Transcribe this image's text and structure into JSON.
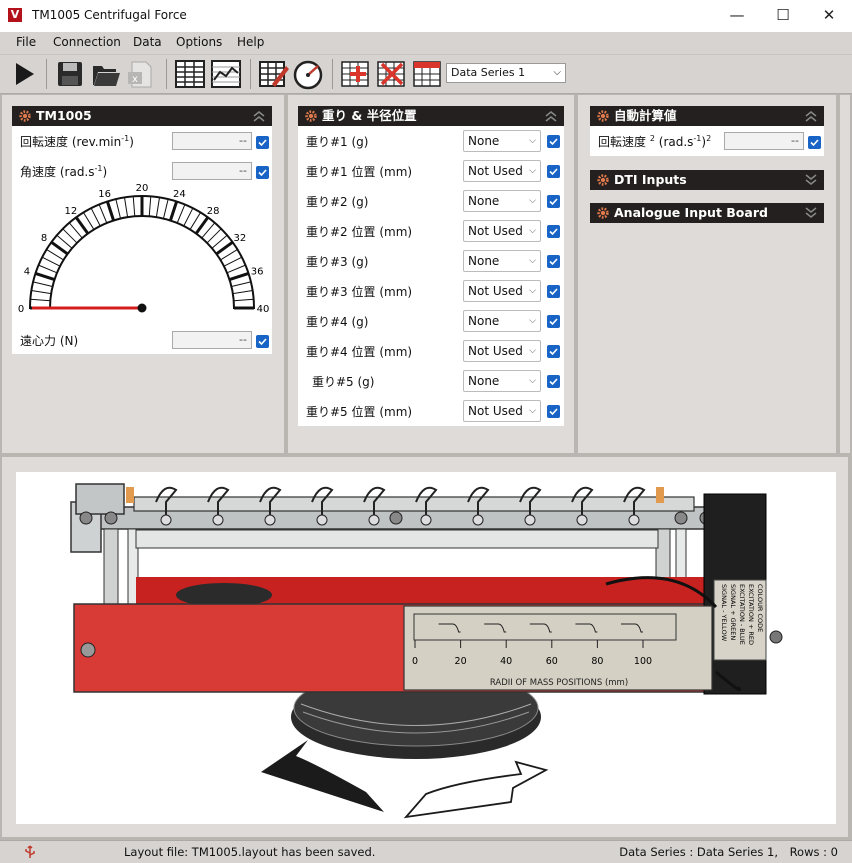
{
  "window": {
    "app_icon_letter": "V",
    "title": "TM1005 Centrifugal Force",
    "minimize": "—",
    "maximize": "☐",
    "close": "✕"
  },
  "menu": [
    "File",
    "Connection",
    "Data",
    "Options",
    "Help"
  ],
  "toolbar": {
    "series_value": "Data Series 1",
    "icons": [
      "play-icon",
      "save-icon",
      "open-folder-icon",
      "excel-export-icon",
      "table-view-icon",
      "chart-view-icon",
      "edit-table-icon",
      "gauge-view-icon",
      "add-series-icon",
      "delete-series-icon",
      "series-table-icon"
    ]
  },
  "panel_tm1005": {
    "title": "TM1005",
    "rpm_label": "回転速度",
    "rpm_unit": "(rev.min",
    "rpm_unit_exp": "-1",
    "rpm_unit_close": ")",
    "rpm_value": "--",
    "ang_label": "角速度",
    "ang_unit": "(rad.s",
    "ang_unit_exp": "-1",
    "ang_unit_close": ")",
    "ang_value": "--",
    "gauge_ticks": [
      "0",
      "4",
      "8",
      "12",
      "16",
      "20",
      "24",
      "28",
      "32",
      "36",
      "40"
    ],
    "gauge_value": 0,
    "force_label": "遠心力",
    "force_unit": "(N)",
    "force_value": "--"
  },
  "panel_mass": {
    "title": "重り & 半径位置",
    "rows": [
      {
        "label": "重り#1 (g)",
        "value": "None"
      },
      {
        "label": "重り#1 位置 (mm)",
        "value": "Not Used"
      },
      {
        "label": "重り#2 (g)",
        "value": "None"
      },
      {
        "label": "重り#2 位置 (mm)",
        "value": "Not Used"
      },
      {
        "label": "重り#3 (g)",
        "value": "None"
      },
      {
        "label": "重り#3 位置 (mm)",
        "value": "Not Used"
      },
      {
        "label": "重り#4 (g)",
        "value": "None"
      },
      {
        "label": "重り#4 位置 (mm)",
        "value": "Not Used"
      },
      {
        "label": "重り#5 (g)",
        "value": "None"
      },
      {
        "label": "重り#5 位置 (mm)",
        "value": "Not Used"
      }
    ]
  },
  "panel_calc": {
    "title": "自動計算値",
    "label": "回転速度",
    "label_exp": "2",
    "unit": "(rad.s",
    "unit_exp": "-1",
    "unit_close": ")",
    "unit_exp2": "2",
    "value": "--"
  },
  "panel_dti": {
    "title": "DTI Inputs"
  },
  "panel_analogue": {
    "title": "Analogue Input Board"
  },
  "apparatus": {
    "scale_ticks": [
      "0",
      "20",
      "40",
      "60",
      "80",
      "100"
    ],
    "scale_caption": "RADII OF MASS POSITIONS (mm)",
    "colour_code": [
      "COLOUR CODE",
      "EXCITATION + RED",
      "EXCITATION - BLUE",
      "SIGNAL + GREEN",
      "SIGNAL - YELLOW"
    ]
  },
  "status": {
    "layout_message": "Layout file: TM1005.layout has been saved.",
    "series_info": "Data Series : Data Series 1,",
    "rows_info": "Rows : 0"
  }
}
